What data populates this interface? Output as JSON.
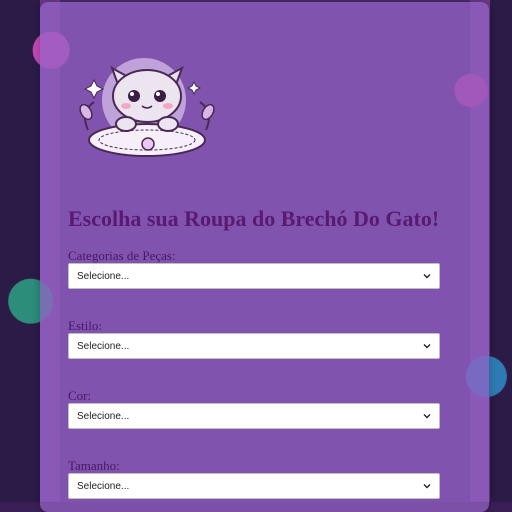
{
  "title": "Escolha sua Roupa do Brechó Do Gato!",
  "fields": [
    {
      "label": "Categorias de Peças:",
      "value": "Selecione..."
    },
    {
      "label": "Estilo:",
      "value": "Selecione..."
    },
    {
      "label": "Cor:",
      "value": "Selecione..."
    },
    {
      "label": "Tamanho:",
      "value": "Selecione..."
    }
  ],
  "icons": {
    "logo": "cat-on-cushion-logo",
    "select": "chevron-down-icon"
  },
  "colors": {
    "title": "#5b1a72",
    "card": "#9664c8"
  }
}
